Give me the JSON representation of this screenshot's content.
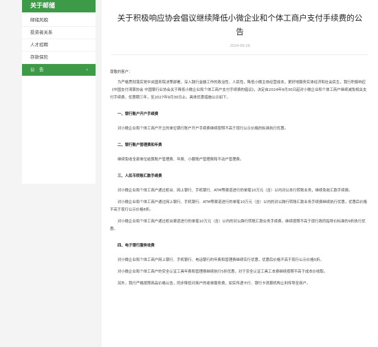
{
  "sidebar": {
    "header": "关于邮储",
    "items": [
      {
        "label": "邮储风貌"
      },
      {
        "label": "投资者关系"
      },
      {
        "label": "人才招聘"
      },
      {
        "label": "存款保险"
      },
      {
        "label": "公　告",
        "chevron": "›"
      }
    ]
  },
  "article": {
    "title": "关于积极响应协会倡议继续降低小微企业和个体工商户支付手续费的公告",
    "date": "2024-09-29",
    "greeting": "尊敬的客户：",
    "intro": "为严格贯彻落实党中央国务院决策部署，深入践行金融工作的政治性、人民性，降低小微主体经营成本，更好地服务实体经济和社会民生，我行积极响应《中国支付清算协会 中国银行业协会关于降低小微企业和个体工商户支付手续费的倡议》，决定自2024年9月30日起对小微企业和个体工商户继续减免相关支付手续费，优惠期三年，至2027年9月30日止。具体优惠措施公示如下。",
    "sections": [
      {
        "heading": "一、银行账户开户手续费",
        "paras": [
          "对小微企业和个体工商户开立的单位银行账户开户手续费继续按照不高于现行公示价格的标准执行优惠。"
        ]
      },
      {
        "heading": "二、银行账户管理费和年费",
        "paras": [
          "继续免收全部单位结算账户管理费、年费、小额账户管理费和不动户管理费。"
        ]
      },
      {
        "heading": "三、人民币转账汇款手续费",
        "paras": [
          "对小微企业和个体工商户通过柜台、网上银行、手机银行、ATM等渠道进行的单笔10万元（含）以内对公本行转账业务，继续免收汇款手续费。",
          "对小微企业和个体工商户通过网上银行、手机银行、ATM等渠道进行的单笔10万元（含）以内的对公跨行转账汇款业务手续费继续执行优惠，优惠后价格不高于现行公示价格8折。",
          "对小微企业和个体工商户通过柜台渠道进行的单笔10万元（含）以内的对公跨行转账汇款业务手续费，继续按照不高于现行政府指导价标准的9折执行优惠。"
        ]
      },
      {
        "heading": "四、电子银行服务收费",
        "paras": [
          "对小微企业和个体工商户网上银行、手机银行、电话银行的年费和管理费继续实行优惠，优惠后价格不高于现行公示价格5折。",
          "对小微企业和个体工商户的安全认证工具年费和管理费继续执行5折优惠，对于安全认证工具工本费继续按照不高于成本价收取。"
        ]
      }
    ],
    "closing": "另外，我行严格按照商品价格公告，同步降低对商户的收单服务费，如实传递卡行、银行卡清算机构让利传导至商户。"
  }
}
